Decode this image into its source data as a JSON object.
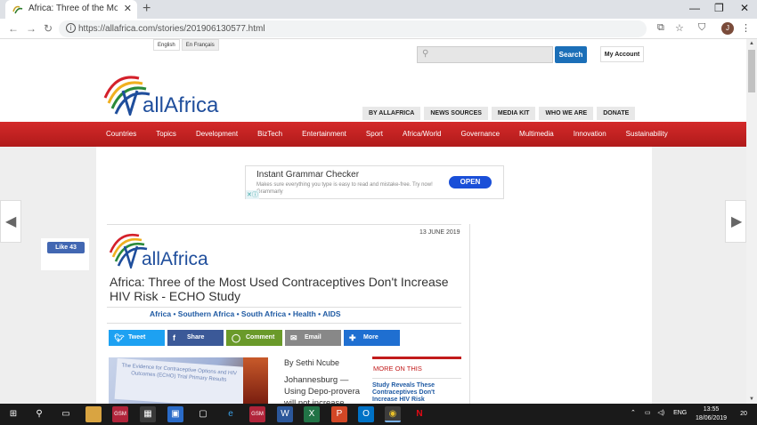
{
  "browser": {
    "tab_title": "Africa: Three of the Most Used C",
    "tab_close": "✕",
    "new_tab": "+",
    "url": "https://allafrica.com/stories/201906130577.html",
    "profile_initial": "J",
    "minimize": "—",
    "maximize": "❐",
    "close": "✕"
  },
  "site": {
    "lang_english": "English",
    "lang_french": "En Français",
    "search_button": "Search",
    "my_account": "My Account",
    "logo_text": "allAfrica",
    "top_links": [
      "BY ALLAFRICA",
      "NEWS SOURCES",
      "MEDIA KIT",
      "WHO WE ARE",
      "DONATE"
    ],
    "nav": [
      "Countries",
      "Topics",
      "Development",
      "BizTech",
      "Entertainment",
      "Sport",
      "Africa/World",
      "Governance",
      "Multimedia",
      "Innovation",
      "Sustainability"
    ]
  },
  "ad": {
    "headline": "Instant Grammar Checker",
    "description": "Makes sure everything you type is easy to read and mistake-free. Try now! Grammarly",
    "cta": "OPEN"
  },
  "facebook": {
    "like_label": "Like 43"
  },
  "article": {
    "date": "13 JUNE 2019",
    "headline": "Africa: Three of the Most Used Contraceptives Don't Increase HIV Risk - ECHO Study",
    "categories": "Africa  •  Southern Africa  •  South Africa  •  Health  •  AIDS",
    "share": {
      "tweet": "Tweet",
      "share": "Share",
      "comment": "Comment",
      "email": "Email",
      "more": "More"
    },
    "photo_text": "The Evidence for Contraceptive Options and HIV Outcomes (ECHO) Trial Primary Results",
    "byline": "By Sethi Ncube",
    "body": "Johannesburg — Using Depo-provera will not increase"
  },
  "more_on_this": {
    "heading": "MORE ON THIS",
    "link": "Study Reveals These Contraceptives Don't Increase HIV Risk"
  },
  "taskbar": {
    "language": "ENG",
    "time": "13:55",
    "date": "18/06/2019",
    "notifications": "20"
  },
  "colors": {
    "nav_red": "#c21b1b",
    "link_blue": "#1f5aa3",
    "search_blue": "#1b6fb8",
    "twitter": "#1da1f2",
    "facebook": "#3b5998",
    "comment": "#6a9a2a",
    "email": "#888888",
    "more": "#1f6fd1"
  }
}
